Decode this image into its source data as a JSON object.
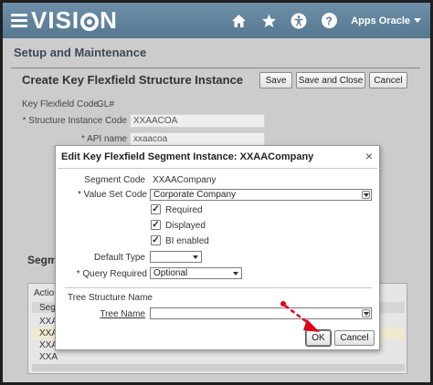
{
  "header": {
    "brand": "VISION",
    "user": "Apps Oracle",
    "help_glyph": "?",
    "icons": [
      "menu-icon",
      "home-icon",
      "favorites-star-icon",
      "accessibility-icon",
      "help-icon"
    ]
  },
  "page": {
    "section_title": "Setup and Maintenance",
    "title": "Create Key Flexfield Structure Instance",
    "buttons": {
      "save": "Save",
      "save_close": "Save and Close",
      "cancel": "Cancel"
    },
    "kff_code_label": "Key Flexfield Code",
    "kff_code_value": "GL#",
    "structure_instance_code_label": "* Structure Instance Code",
    "structure_instance_code_value": "XXAACOA",
    "api_name_label": "* API name",
    "api_name_value": "xxaacoa",
    "segments_label": "Segme",
    "table": {
      "actions_label": "Action",
      "header_cell": "Seg",
      "rows": [
        "XXA",
        "XXA",
        "XXA",
        "XXA"
      ]
    }
  },
  "dialog": {
    "title": "Edit Key Flexfield Segment Instance: XXAACompany",
    "close_glyph": "×",
    "segment_code_label": "Segment Code",
    "segment_code_value": "XXAACompany",
    "value_set_code_label": "* Value Set Code",
    "value_set_code_value": "Corporate Company",
    "required_label": "Required",
    "required_checked": true,
    "displayed_label": "Displayed",
    "displayed_checked": true,
    "bi_enabled_label": "BI enabled",
    "bi_enabled_checked": true,
    "check_glyph": "✓",
    "default_type_label": "Default Type",
    "default_type_value": "",
    "query_required_label": "* Query Required",
    "query_required_value": "Optional",
    "tree_structure_name_label": "Tree Structure Name",
    "tree_name_label": "Tree Name",
    "tree_name_value": "",
    "ok_label": "OK",
    "cancel_label": "Cancel"
  },
  "colors": {
    "header_bar": "#5f819b",
    "page_background": "#cccccc",
    "annotation_arrow": "#e0001b"
  }
}
